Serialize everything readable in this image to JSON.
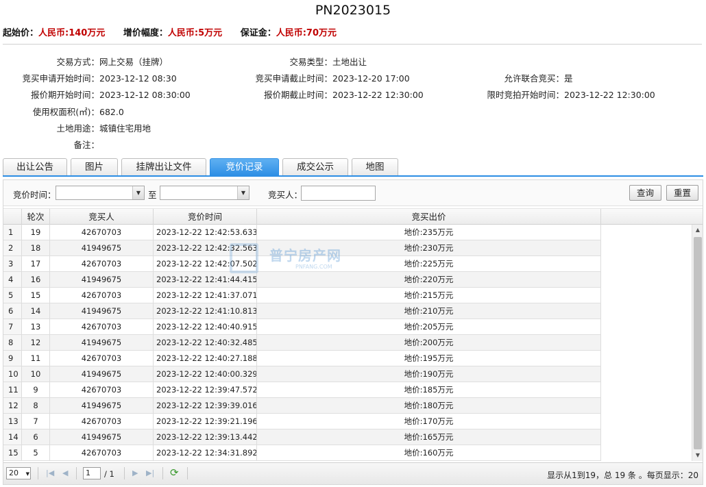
{
  "title": "PN2023015",
  "prices": [
    {
      "label": "起始价：",
      "value": "人民币:140万元"
    },
    {
      "label": "增价幅度：",
      "value": "人民币:5万元"
    },
    {
      "label": "保证金：",
      "value": "人民币:70万元"
    }
  ],
  "info": {
    "trade_method": {
      "label": "交易方式：",
      "value": "网上交易（挂牌）"
    },
    "trade_type": {
      "label": "交易类型：",
      "value": "土地出让"
    },
    "apply_start": {
      "label": "竞买申请开始时间：",
      "value": "2023-12-12 08:30"
    },
    "apply_end": {
      "label": "竞买申请截止时间：",
      "value": "2023-12-20 17:00"
    },
    "joint_bid": {
      "label": "允许联合竞买：",
      "value": "是"
    },
    "quote_start": {
      "label": "报价期开始时间：",
      "value": "2023-12-12 08:30:00"
    },
    "quote_end": {
      "label": "报价期截止时间：",
      "value": "2023-12-22 12:30:00"
    },
    "auction_start": {
      "label": "限时竞拍开始时间：",
      "value": "2023-12-22 12:30:00"
    },
    "area": {
      "label": "使用权面积(㎡)：",
      "value": "682.0"
    },
    "usage": {
      "label": "土地用途：",
      "value": "城镇住宅用地"
    },
    "remark": {
      "label": "备注：",
      "value": ""
    }
  },
  "tabs": [
    "出让公告",
    "图片",
    "挂牌出让文件",
    "竞价记录",
    "成交公示",
    "地图"
  ],
  "active_tab": "竞价记录",
  "filter": {
    "time_label": "竞价时间：",
    "to_label": "至",
    "bidder_label": "竞买人：",
    "query_btn": "查询",
    "reset_btn": "重置"
  },
  "table": {
    "headers": [
      "轮次",
      "竞买人",
      "竞价时间",
      "竞买出价"
    ],
    "rows": [
      {
        "idx": "1",
        "round": "19",
        "bidder": "42670703",
        "time": "2023-12-22 12:42:53.633",
        "price": "地价:235万元"
      },
      {
        "idx": "2",
        "round": "18",
        "bidder": "41949675",
        "time": "2023-12-22 12:42:32.563",
        "price": "地价:230万元"
      },
      {
        "idx": "3",
        "round": "17",
        "bidder": "42670703",
        "time": "2023-12-22 12:42:07.502",
        "price": "地价:225万元"
      },
      {
        "idx": "4",
        "round": "16",
        "bidder": "41949675",
        "time": "2023-12-22 12:41:44.415",
        "price": "地价:220万元"
      },
      {
        "idx": "5",
        "round": "15",
        "bidder": "42670703",
        "time": "2023-12-22 12:41:37.071",
        "price": "地价:215万元"
      },
      {
        "idx": "6",
        "round": "14",
        "bidder": "41949675",
        "time": "2023-12-22 12:41:10.813",
        "price": "地价:210万元"
      },
      {
        "idx": "7",
        "round": "13",
        "bidder": "42670703",
        "time": "2023-12-22 12:40:40.915",
        "price": "地价:205万元"
      },
      {
        "idx": "8",
        "round": "12",
        "bidder": "41949675",
        "time": "2023-12-22 12:40:32.485",
        "price": "地价:200万元"
      },
      {
        "idx": "9",
        "round": "11",
        "bidder": "42670703",
        "time": "2023-12-22 12:40:27.188",
        "price": "地价:195万元"
      },
      {
        "idx": "10",
        "round": "10",
        "bidder": "41949675",
        "time": "2023-12-22 12:40:00.329",
        "price": "地价:190万元"
      },
      {
        "idx": "11",
        "round": "9",
        "bidder": "42670703",
        "time": "2023-12-22 12:39:47.572",
        "price": "地价:185万元"
      },
      {
        "idx": "12",
        "round": "8",
        "bidder": "41949675",
        "time": "2023-12-22 12:39:39.016",
        "price": "地价:180万元"
      },
      {
        "idx": "13",
        "round": "7",
        "bidder": "42670703",
        "time": "2023-12-22 12:39:21.196",
        "price": "地价:170万元"
      },
      {
        "idx": "14",
        "round": "6",
        "bidder": "41949675",
        "time": "2023-12-22 12:39:13.442",
        "price": "地价:165万元"
      },
      {
        "idx": "15",
        "round": "5",
        "bidder": "42670703",
        "time": "2023-12-22 12:34:31.892",
        "price": "地价:160万元"
      }
    ]
  },
  "watermark": {
    "title": "普宁房产网",
    "sub": "PNFANG.COM"
  },
  "pager": {
    "page_size": "20",
    "page": "1",
    "of_total": "/ 1",
    "info": "显示从1到19，总 19 条 。每页显示：20"
  },
  "colors": {
    "accent": "#2b8de4",
    "price_red": "#c00000"
  }
}
